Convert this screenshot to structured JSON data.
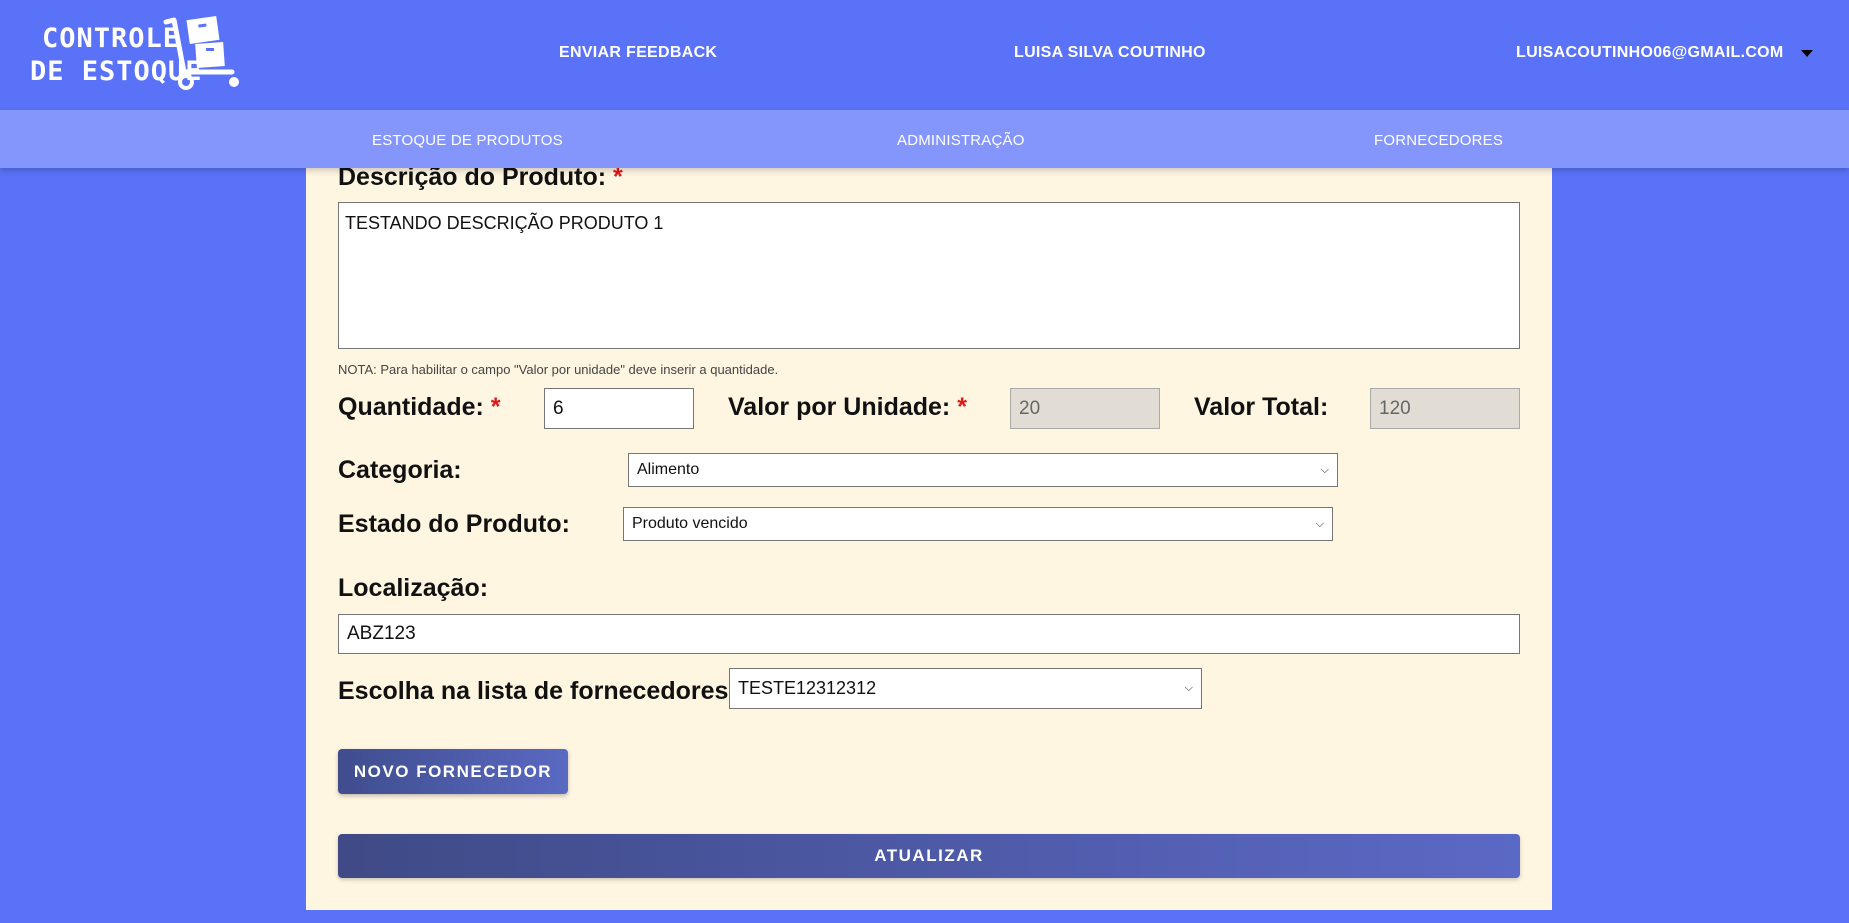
{
  "header": {
    "logo_line1": "CONTROLE",
    "logo_line2": "DE ESTOQUE",
    "feedback_link": "ENVIAR FEEDBACK",
    "username": "LUISA SILVA COUTINHO",
    "email": "LUISACOUTINHO06@GMAIL.COM"
  },
  "nav": {
    "items": [
      "ESTOQUE DE PRODUTOS",
      "ADMINISTRAÇÃO",
      "FORNECEDORES"
    ]
  },
  "form": {
    "description_label": "Descrição do Produto:",
    "required_mark": "*",
    "description_value": "TESTANDO DESCRIÇÃO PRODUTO 1",
    "note": "NOTA: Para habilitar o campo \"Valor por unidade\" deve inserir a quantidade.",
    "quantity_label": "Quantidade:",
    "quantity_value": "6",
    "unit_value_label": "Valor por Unidade:",
    "unit_value": "20",
    "total_label": "Valor Total:",
    "total_value": "120",
    "category_label": "Categoria:",
    "category_value": "Alimento",
    "state_label": "Estado do Produto:",
    "state_value": "Produto vencido",
    "location_label": "Localização:",
    "location_value": "ABZ123",
    "supplier_label": "Escolha na lista de fornecedores:",
    "supplier_value": "TESTE12312312",
    "new_supplier_button": "NOVO FORNECEDOR",
    "update_button": "ATUALIZAR"
  },
  "colors": {
    "header_bg": "#5a72f8",
    "nav_bg": "#8496fb",
    "panel_bg": "#fff6e2",
    "required": "#e01818",
    "button": "#4a58a6"
  },
  "icons": {
    "logo": "hand-truck-boxes-icon",
    "user_menu": "caret-down-icon",
    "select": "chevron-down-icon"
  }
}
